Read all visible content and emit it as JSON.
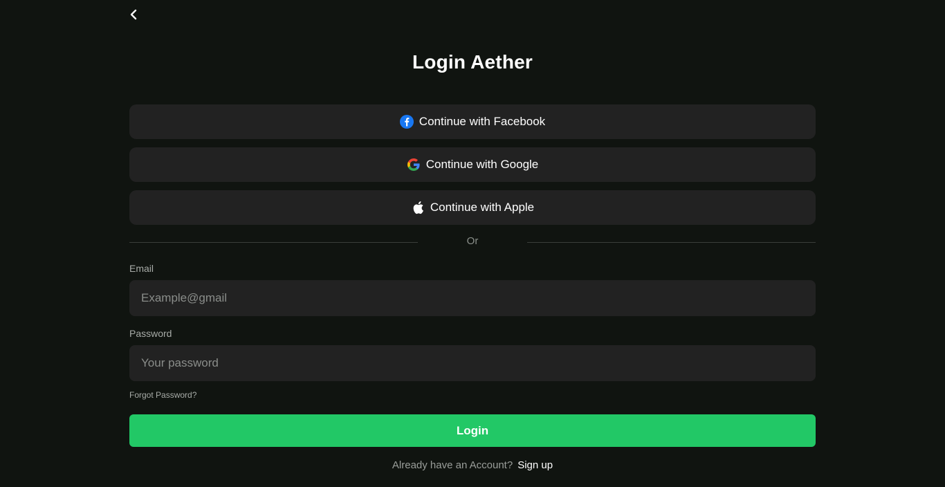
{
  "header": {
    "back_icon": "chevron-left-icon",
    "title": "Login Aether"
  },
  "social": {
    "facebook": {
      "label": "Continue with Facebook",
      "icon": "facebook-icon",
      "color": "#1877F2"
    },
    "google": {
      "label": "Continue with Google",
      "icon": "google-icon"
    },
    "apple": {
      "label": "Continue with Apple",
      "icon": "apple-icon"
    }
  },
  "divider": {
    "label": "Or"
  },
  "form": {
    "email": {
      "label": "Email",
      "value": "",
      "placeholder": "Example@gmail"
    },
    "password": {
      "label": "Password",
      "value": "",
      "placeholder": "Your password"
    },
    "forgot_label": "Forgot Password?",
    "login_label": "Login"
  },
  "footer": {
    "prompt": "Already have an Account?",
    "signup_label": "Sign up"
  },
  "colors": {
    "background": "#101410",
    "surface": "#222222",
    "accent": "#22C866"
  }
}
